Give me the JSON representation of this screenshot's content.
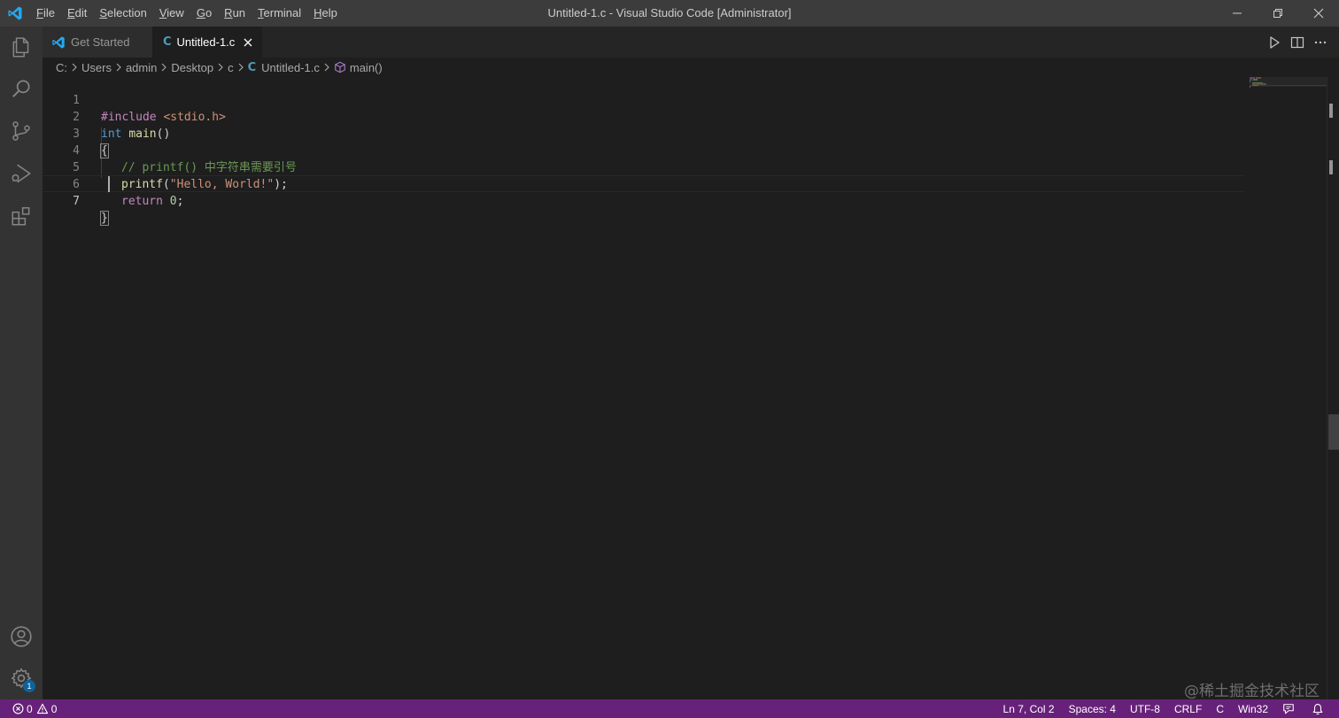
{
  "window": {
    "title": "Untitled-1.c - Visual Studio Code [Administrator]"
  },
  "menu": [
    {
      "underline": "F",
      "rest": "ile"
    },
    {
      "underline": "E",
      "rest": "dit"
    },
    {
      "underline": "S",
      "rest": "election"
    },
    {
      "underline": "V",
      "rest": "iew"
    },
    {
      "underline": "G",
      "rest": "o"
    },
    {
      "underline": "R",
      "rest": "un"
    },
    {
      "underline": "T",
      "rest": "erminal"
    },
    {
      "underline": "H",
      "rest": "elp"
    }
  ],
  "tabs": {
    "inactive_label": "Get Started",
    "active_label": "Untitled-1.c",
    "file_type_glyph": "C"
  },
  "breadcrumb": {
    "parts": [
      "C:",
      "Users",
      "admin",
      "Desktop",
      "c"
    ],
    "file": "Untitled-1.c",
    "symbol": "main()"
  },
  "code": {
    "line_numbers": [
      "1",
      "2",
      "3",
      "4",
      "5",
      "6",
      "7"
    ],
    "l1_pp": "#include",
    "l1_inc": "<stdio.h>",
    "l2_kw": "int",
    "l2_fn": "main",
    "l2_punc": "()",
    "l3_brace": "{",
    "l4_comment": "// printf() 中字符串需要引号",
    "l5_fn": "printf",
    "l5_open": "(",
    "l5_str": "\"Hello, World!\"",
    "l5_close": ");",
    "l6_kw": "return",
    "l6_num": "0",
    "l6_semi": ";",
    "l7_brace": "}"
  },
  "watermark": "@稀土掘金技术社区",
  "statusbar": {
    "errors": "0",
    "warnings": "0",
    "position": "Ln 7, Col 2",
    "spaces": "Spaces: 4",
    "encoding": "UTF-8",
    "eol": "CRLF",
    "language": "C",
    "platform": "Win32"
  },
  "accounts_badge": "1",
  "colors": {
    "statusbar": "#68217a",
    "titlebar": "#3c3c3c",
    "activitybar": "#333333",
    "editor": "#1e1e1e",
    "vscode_blue": "#23a9f2"
  }
}
